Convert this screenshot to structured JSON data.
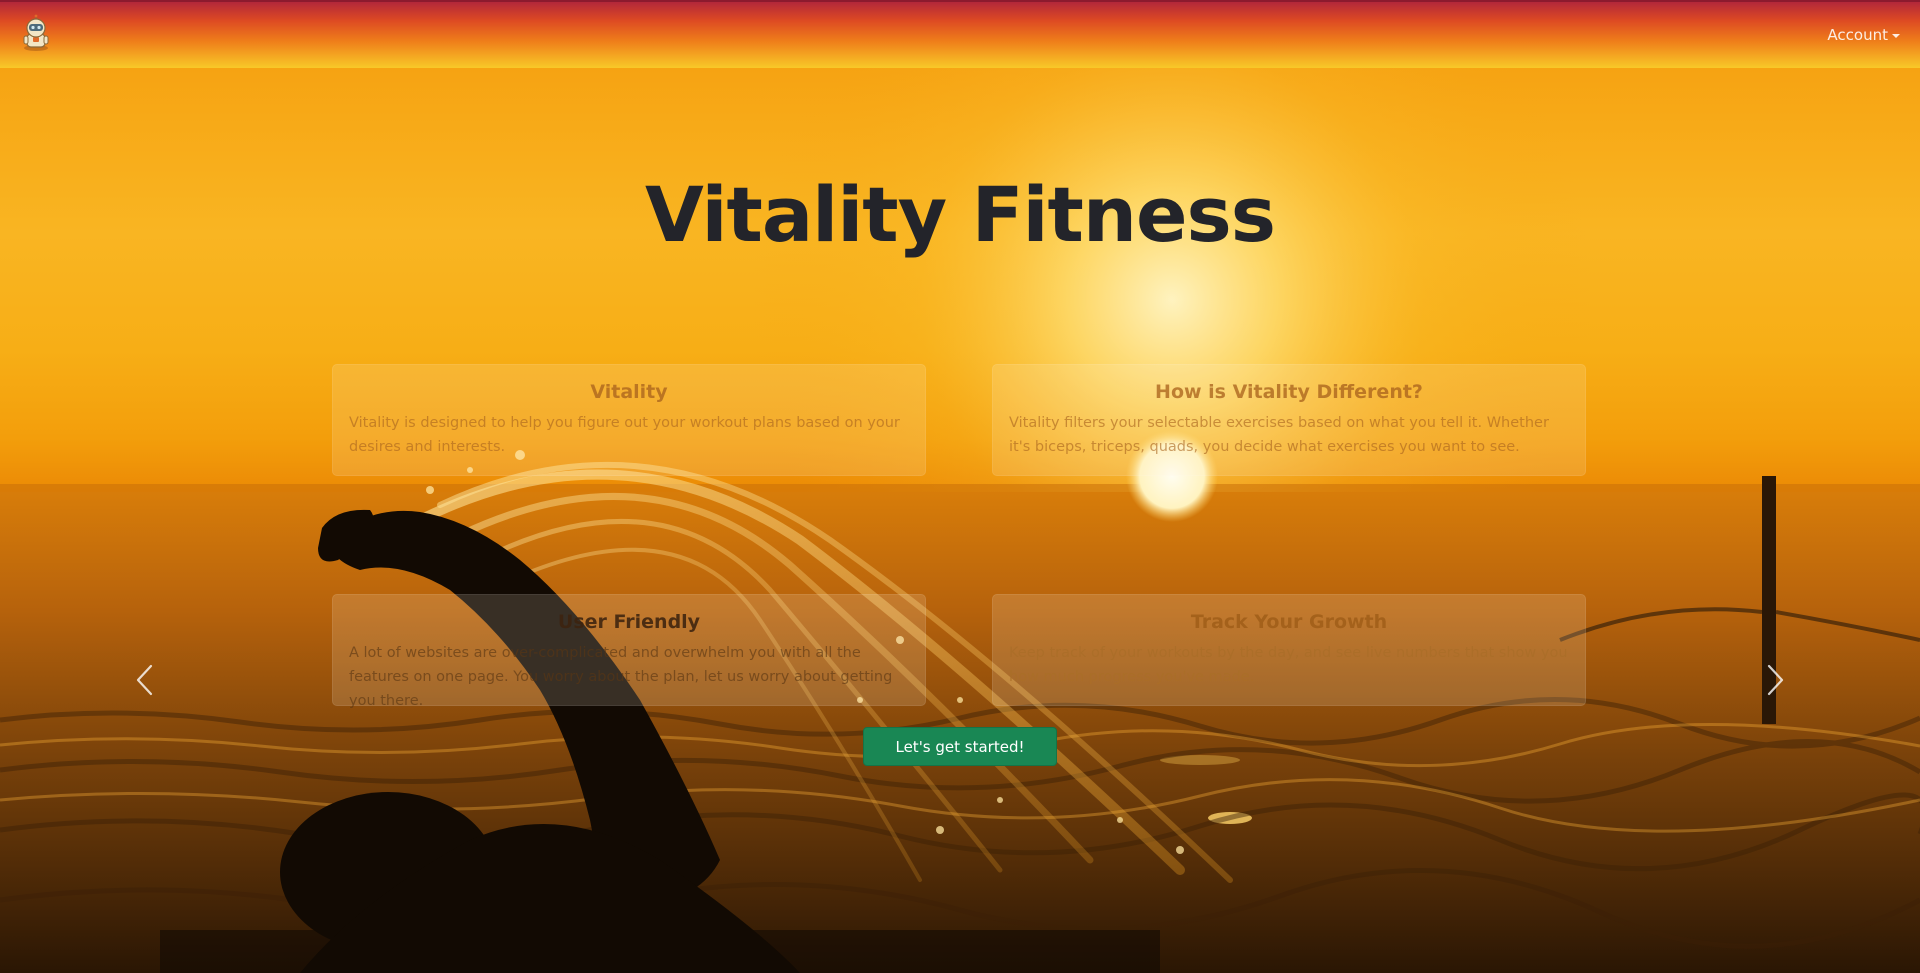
{
  "navbar": {
    "logo_icon": "robot-mascot-icon",
    "account_label": "Account",
    "account_icon": "caret-down-icon"
  },
  "hero": {
    "title": "Vitality Fitness",
    "cta_label": "Let's get started!",
    "prev_icon": "chevron-left-icon",
    "next_icon": "chevron-right-icon"
  },
  "features": [
    {
      "title": "Vitality",
      "text": "Vitality is designed to help you figure out your workout plans based on your desires and interests."
    },
    {
      "title": "How is Vitality Different?",
      "text": "Vitality filters your selectable exercises based on what you tell it. Whether it's biceps, triceps, quads, you decide what exercises you want to see."
    },
    {
      "title": "User Friendly",
      "text": "A lot of websites are over-complicated and overwhelm you with all the features on one page. You worry about the plan, let us worry about getting you there."
    },
    {
      "title": "Track Your Growth",
      "text": "Keep track of your workouts by the day, and see live numbers that show you how much progress you've made."
    }
  ],
  "colors": {
    "navbar_top": "#b3273a",
    "navbar_bottom": "#f8c928",
    "cta": "#198754",
    "title": "#23242a"
  }
}
